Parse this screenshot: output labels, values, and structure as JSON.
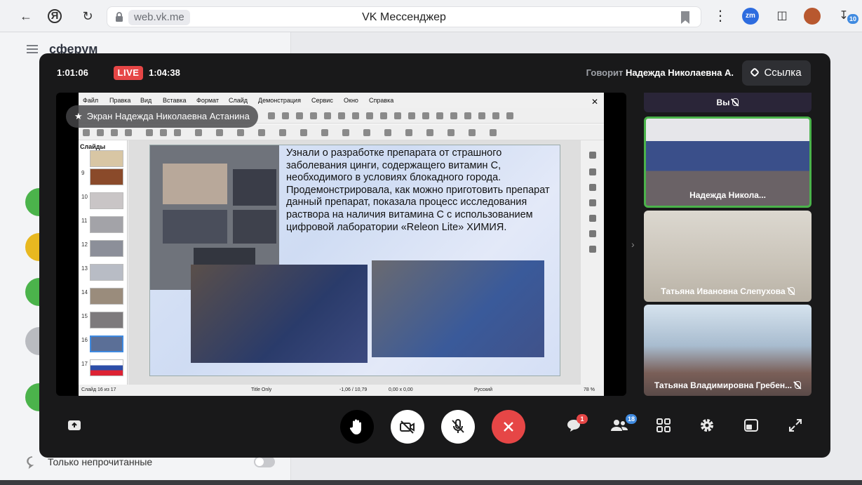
{
  "browser": {
    "url": "web.vk.me",
    "tab_title": "VK Мессенджер",
    "ext_zoom_label": "zm",
    "downloads_count": "10"
  },
  "app": {
    "brand": "сферум",
    "filter_label": "Только непрочитанные"
  },
  "call": {
    "elapsed_time": "1:01:06",
    "live_label": "LIVE",
    "live_time": "1:04:38",
    "speaking_prefix": "Говорит",
    "speaking_name": "Надежда Николаевна А.",
    "link_button": "Ссылка",
    "presenter_chip": "Экран Надежда Николаевна Астанина"
  },
  "presentation": {
    "menu": [
      "Файл",
      "Правка",
      "Вид",
      "Вставка",
      "Формат",
      "Слайд",
      "Демонстрация",
      "Сервис",
      "Окно",
      "Справка"
    ],
    "slides_header": "Слайды",
    "slide_numbers": [
      "9",
      "10",
      "11",
      "12",
      "13",
      "14",
      "15",
      "16",
      "17"
    ],
    "current_slide_text": "Узнали о разработке препарата от страшного заболевания цинги, содержащего витамин С, необходимого в условиях блокадного города. Продемонстрировала, как можно приготовить препарат данный препарат, показала процесс исследования раствора на наличия витамина С с использованием цифровой лаборатории «Releon Lite» ХИМИЯ.",
    "status_slide": "Слайд 16 из 17",
    "status_layout": "Title Only",
    "status_coords": "-1,06 / 10,79",
    "status_size": "0,00 x 0,00",
    "status_lang": "Русский",
    "status_zoom": "78 %"
  },
  "participants": [
    {
      "name": "Вы",
      "muted": true
    },
    {
      "name": "Надежда Никола...",
      "muted": false,
      "active": true
    },
    {
      "name": "Татьяна Ивановна Слепухова",
      "muted": true
    },
    {
      "name": "Татьяна Владимировна Гребен...",
      "muted": true
    }
  ],
  "controls": {
    "chat_badge": "1",
    "participants_badge": "18"
  },
  "colors": {
    "live_red": "#e64646",
    "end_call_red": "#e64646",
    "active_speaker_green": "#4bb34b",
    "badge_blue": "#3f8ae0"
  }
}
